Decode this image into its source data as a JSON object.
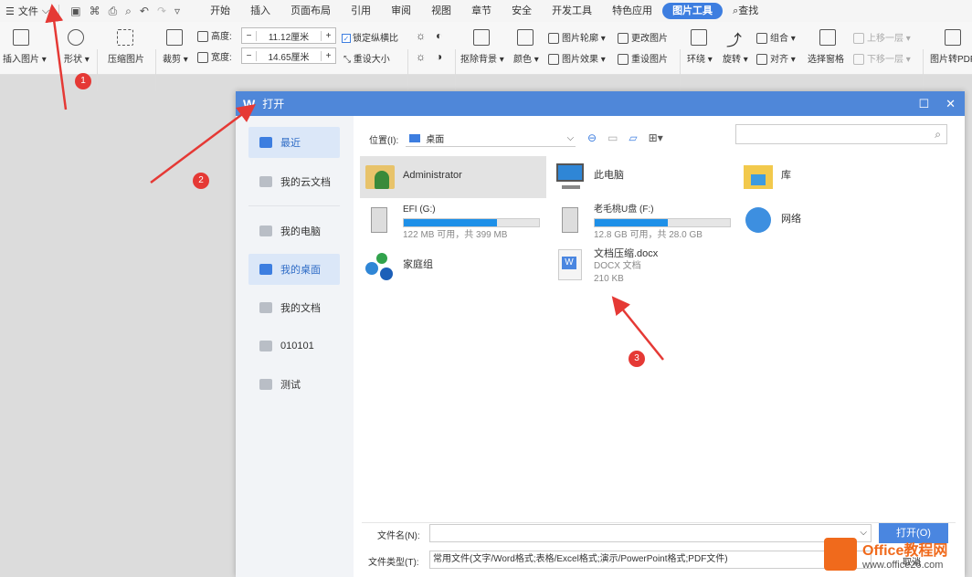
{
  "menubar": {
    "file_label": "文件",
    "tabs": [
      {
        "label": "开始"
      },
      {
        "label": "插入"
      },
      {
        "label": "页面布局"
      },
      {
        "label": "引用"
      },
      {
        "label": "审阅"
      },
      {
        "label": "视图"
      },
      {
        "label": "章节"
      },
      {
        "label": "安全"
      },
      {
        "label": "开发工具"
      },
      {
        "label": "特色应用"
      },
      {
        "label": "图片工具"
      },
      {
        "label": "查找"
      }
    ]
  },
  "ribbon": {
    "insert_picture": "插入图片",
    "shape": "形状",
    "compress": "压缩图片",
    "crop": "裁剪",
    "height_label": "高度:",
    "height_value": "11.12厘米",
    "width_label": "宽度:",
    "width_value": "14.65厘米",
    "lock_ratio": "锁定纵横比",
    "reset_size": "重设大小",
    "remove_bg": "抠除背景",
    "color": "颜色",
    "outline": "图片轮廓",
    "effect": "图片效果",
    "change_pic": "更改图片",
    "reset_pic": "重设图片",
    "wrap": "环绕",
    "rotate": "旋转",
    "group": "组合",
    "align": "对齐",
    "select_pane": "选择窗格",
    "bring_forward": "上移一层",
    "send_backward": "下移一层",
    "to_pdf": "图片转PDF"
  },
  "dialog": {
    "title": "打开",
    "sidebar": [
      {
        "label": "最近"
      },
      {
        "label": "我的云文档"
      },
      {
        "label": "我的电脑"
      },
      {
        "label": "我的桌面"
      },
      {
        "label": "我的文档"
      },
      {
        "label": "010101"
      },
      {
        "label": "测试"
      }
    ],
    "location_label": "位置(I):",
    "location_value": "桌面",
    "entries": {
      "admin": {
        "name": "Administrator"
      },
      "pc": {
        "name": "此电脑"
      },
      "lib": {
        "name": "库"
      },
      "efi": {
        "name": "EFI (G:)",
        "info": "122 MB 可用，共 399 MB",
        "used": 0.69
      },
      "usb": {
        "name": "老毛桃U盘 (F:)",
        "info": "12.8 GB 可用，共 28.0 GB",
        "used": 0.54
      },
      "net": {
        "name": "网络"
      },
      "home": {
        "name": "家庭组"
      },
      "doc": {
        "name": "文档压缩.docx",
        "type": "DOCX 文档",
        "size": "210 KB"
      }
    },
    "filename_label": "文件名(N):",
    "filetype_label": "文件类型(T):",
    "filetype_value": "常用文件(文字/Word格式;表格/Excel格式;演示/PowerPoint格式;PDF文件)",
    "open_button": "打开(O)",
    "cancel_button": "取消"
  },
  "annotations": [
    "1",
    "2",
    "3"
  ],
  "watermark": {
    "line1": "Office教程网",
    "line2": "www.office26.com"
  },
  "colors": {
    "accent": "#4f87d9",
    "annotation": "#e53935",
    "brand": "#f06a1c"
  }
}
